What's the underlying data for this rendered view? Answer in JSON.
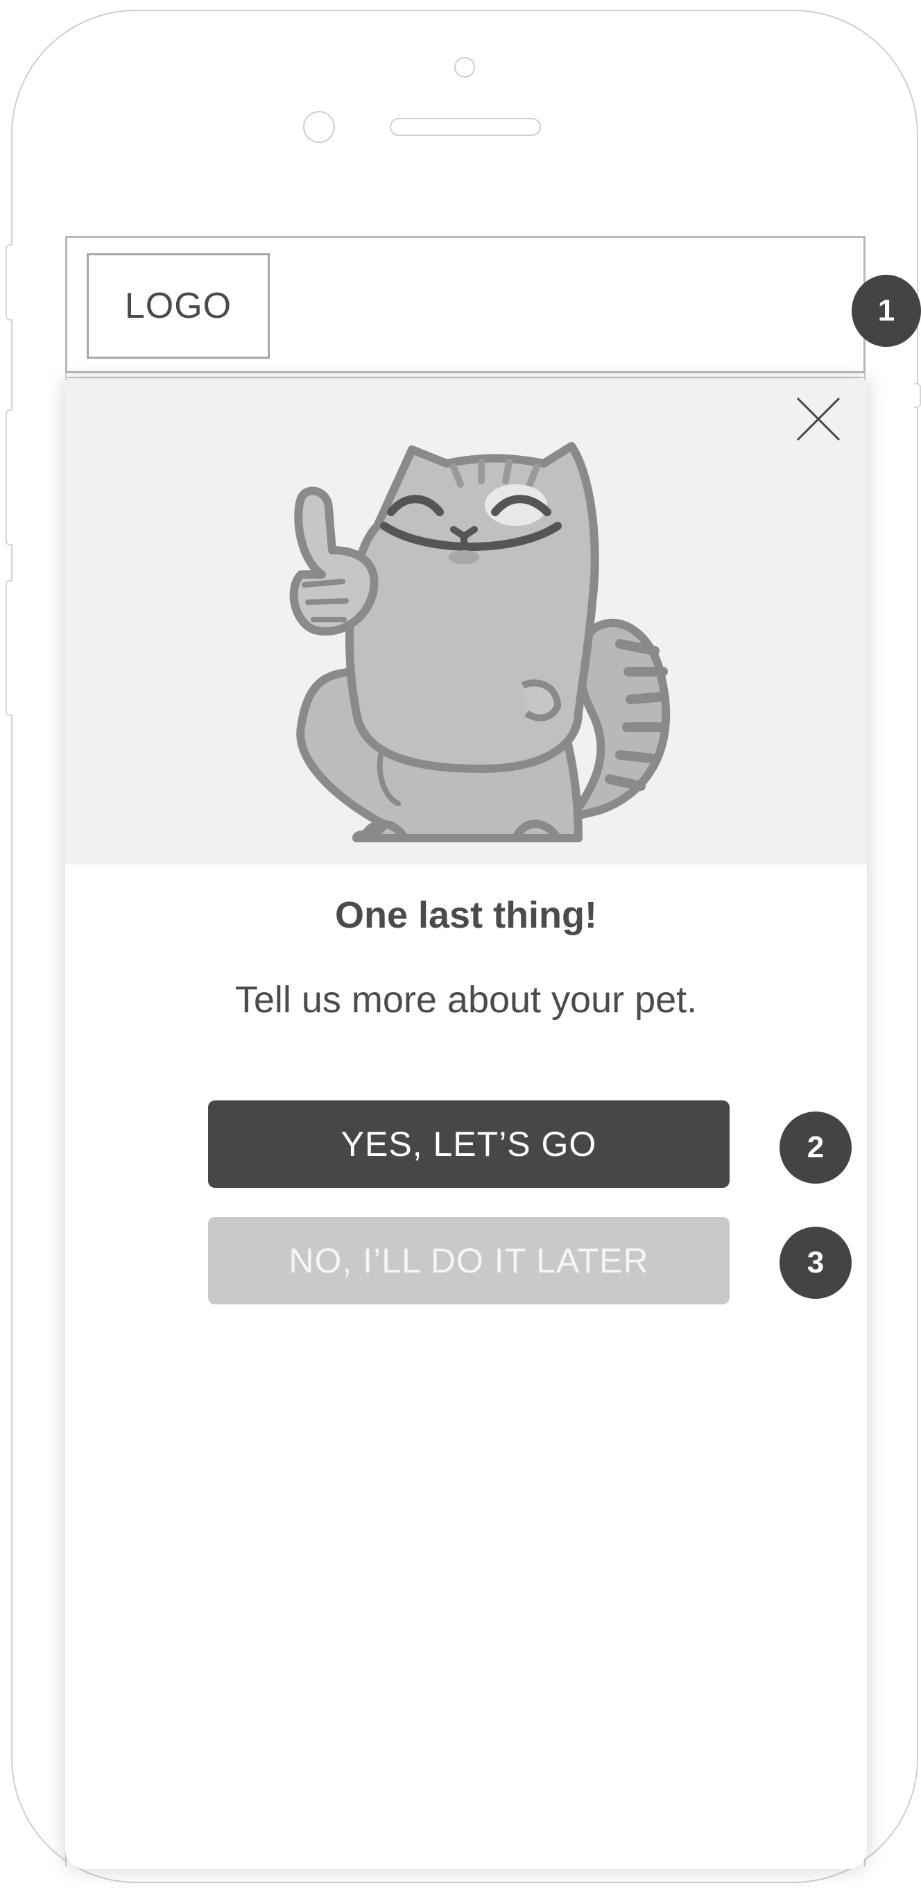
{
  "header": {
    "logo_text": "LOGO"
  },
  "annotations": [
    "1",
    "2",
    "3"
  ],
  "modal": {
    "title": "One last thing!",
    "subtitle": "Tell us more about your pet.",
    "primary_button": "YES, LET’S GO",
    "secondary_button": "NO, I’LL DO IT LATER",
    "close_icon": "close-icon",
    "illustration_icon": "cat-thumbs-up-icon"
  },
  "colors": {
    "primary_button": "#474747",
    "secondary_button": "#c9c9c9",
    "hero_background": "#f2f1f0",
    "badge": "#444444"
  }
}
